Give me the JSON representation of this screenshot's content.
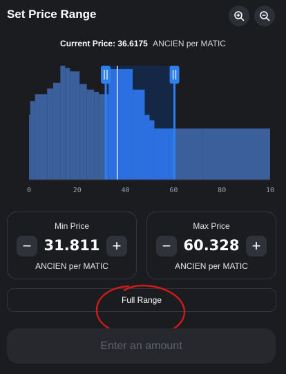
{
  "header": {
    "title": "Set Price Range",
    "zoom_in_icon": "zoom-in-icon",
    "zoom_out_icon": "zoom-out-icon"
  },
  "current_price": {
    "label": "Current Price:",
    "value": "36.6175",
    "unit": "ANCIEN per MATIC"
  },
  "chart_data": {
    "type": "area",
    "x_ticks": [
      "0",
      "20",
      "40",
      "60",
      "80",
      "10"
    ],
    "xlim": [
      0,
      100
    ],
    "liquidity_steps": [
      {
        "x": 0,
        "y": 0.57
      },
      {
        "x": 0.5,
        "y": 0.69
      },
      {
        "x": 2.5,
        "y": 0.75
      },
      {
        "x": 7.5,
        "y": 0.8
      },
      {
        "x": 10,
        "y": 0.85
      },
      {
        "x": 13,
        "y": 1.0
      },
      {
        "x": 15,
        "y": 0.98
      },
      {
        "x": 17,
        "y": 0.95
      },
      {
        "x": 21,
        "y": 0.84
      },
      {
        "x": 24,
        "y": 0.79
      },
      {
        "x": 27,
        "y": 0.77
      },
      {
        "x": 29,
        "y": 0.75
      },
      {
        "x": 33,
        "y": 0.97
      },
      {
        "x": 37,
        "y": 0.97
      },
      {
        "x": 43,
        "y": 0.79
      },
      {
        "x": 48,
        "y": 0.57
      },
      {
        "x": 50,
        "y": 0.52
      },
      {
        "x": 52,
        "y": 0.45
      },
      {
        "x": 58,
        "y": 0.45
      },
      {
        "x": 60,
        "y": 0.45
      },
      {
        "x": 72,
        "y": 0.45
      },
      {
        "x": 100,
        "y": 0.45
      }
    ],
    "current_price": 36.6175,
    "selected_range": [
      31.811,
      60.328
    ],
    "colors": {
      "liquidity": "#3a5f9b",
      "selected": "#2c6fe0",
      "band": "#142846",
      "handle": "#2f80ed",
      "current_line": "#e8eaf0"
    }
  },
  "min_price": {
    "label": "Min Price",
    "value": "31.811",
    "unit": "ANCIEN per MATIC",
    "minus": "−",
    "plus": "+"
  },
  "max_price": {
    "label": "Max Price",
    "value": "60.328",
    "unit": "ANCIEN per MATIC",
    "minus": "−",
    "plus": "+"
  },
  "full_range_label": "Full Range",
  "enter_amount_label": "Enter an amount"
}
